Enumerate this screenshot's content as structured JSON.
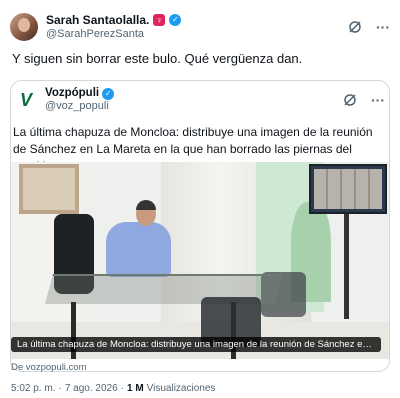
{
  "tweet": {
    "author": {
      "display_name": "Sarah Santaolalla.",
      "handle": "@SarahPerezSanta",
      "badge_icon": "female-sign-badge",
      "verified": true
    },
    "text": "Y siguen sin borrar este bulo. Qué vergüenza dan.",
    "time": "5:02 p. m.",
    "date": "7 ago. 2026",
    "views_count": "1 M",
    "views_label": "Visualizaciones"
  },
  "quote": {
    "author": {
      "display_name": "Vozpópuli",
      "handle": "@voz_populi",
      "logo_letter": "V",
      "verified": true
    },
    "text": "La última chapuza de Moncloa: distribuye una imagen de la reunión de Sánchez en La Mareta en la que han borrado las piernas del presidente",
    "image_caption": "La última chapuza de Moncloa: distribuye una imagen de la reunión de Sánchez en La Ma...",
    "source": "De vozpopuli.com"
  },
  "icons": {
    "grok": "grok-icon",
    "more": "more-icon",
    "verified": "verified-icon"
  },
  "colors": {
    "verified_blue": "#1d9bf0",
    "secondary_text": "#536471",
    "border": "#cfd9de"
  }
}
